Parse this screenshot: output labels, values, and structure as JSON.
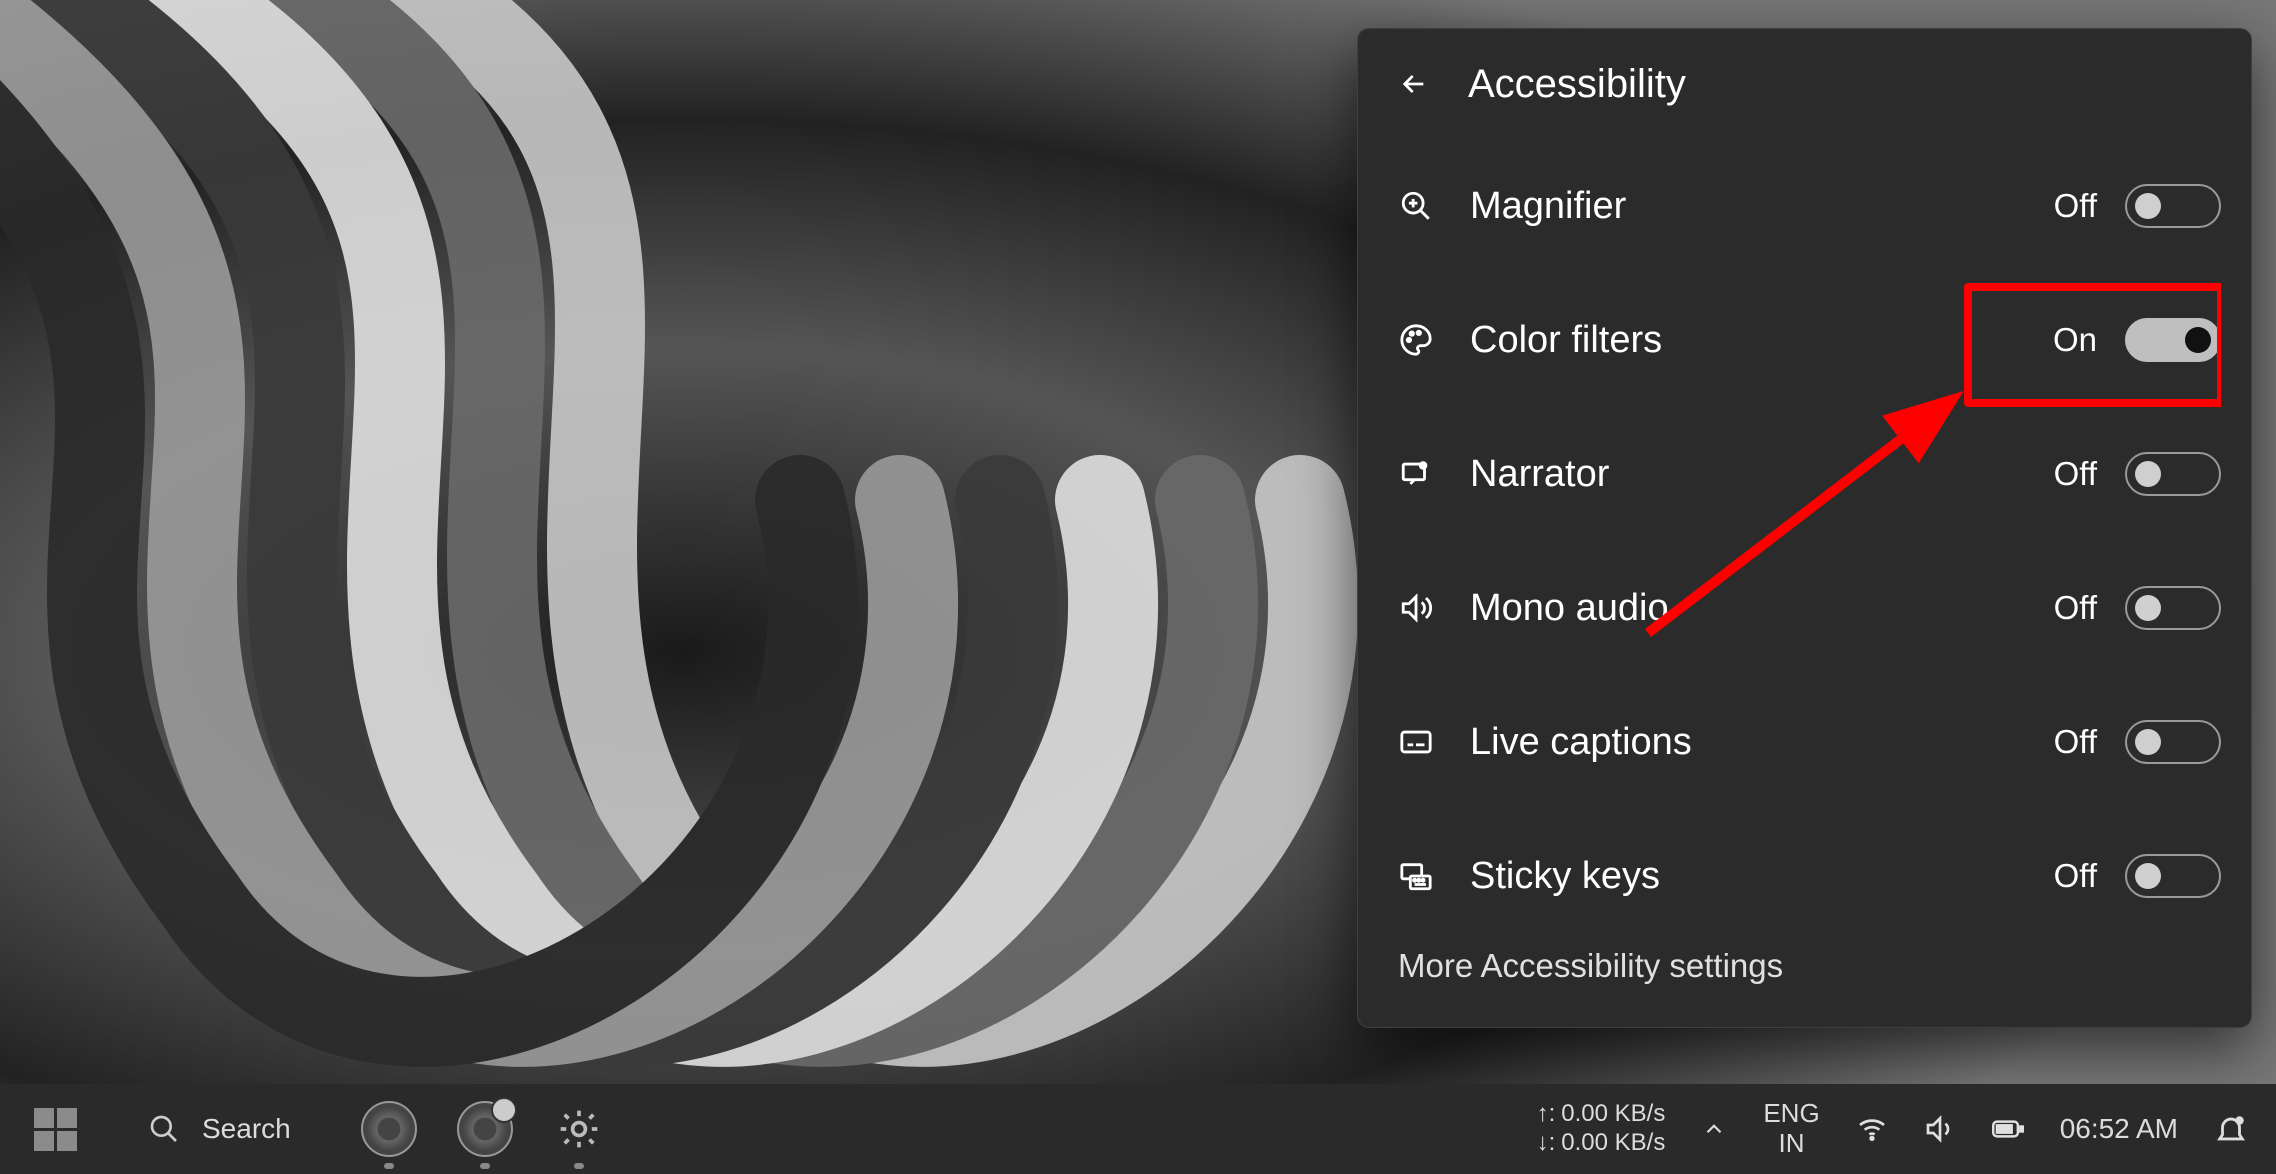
{
  "panel": {
    "title": "Accessibility",
    "items": [
      {
        "icon": "magnifier",
        "label": "Magnifier",
        "status": "Off",
        "on": false
      },
      {
        "icon": "palette",
        "label": "Color filters",
        "status": "On",
        "on": true,
        "highlighted": true
      },
      {
        "icon": "narrator",
        "label": "Narrator",
        "status": "Off",
        "on": false
      },
      {
        "icon": "audio",
        "label": "Mono audio",
        "status": "Off",
        "on": false
      },
      {
        "icon": "captions",
        "label": "Live captions",
        "status": "Off",
        "on": false
      },
      {
        "icon": "sticky",
        "label": "Sticky keys",
        "status": "Off",
        "on": false
      }
    ],
    "more_link": "More Accessibility settings"
  },
  "taskbar": {
    "search_label": "Search",
    "net_up": "0.00 KB/s",
    "net_down": "0.00 KB/s",
    "lang_top": "ENG",
    "lang_bottom": "IN",
    "clock": "06:52 AM"
  }
}
